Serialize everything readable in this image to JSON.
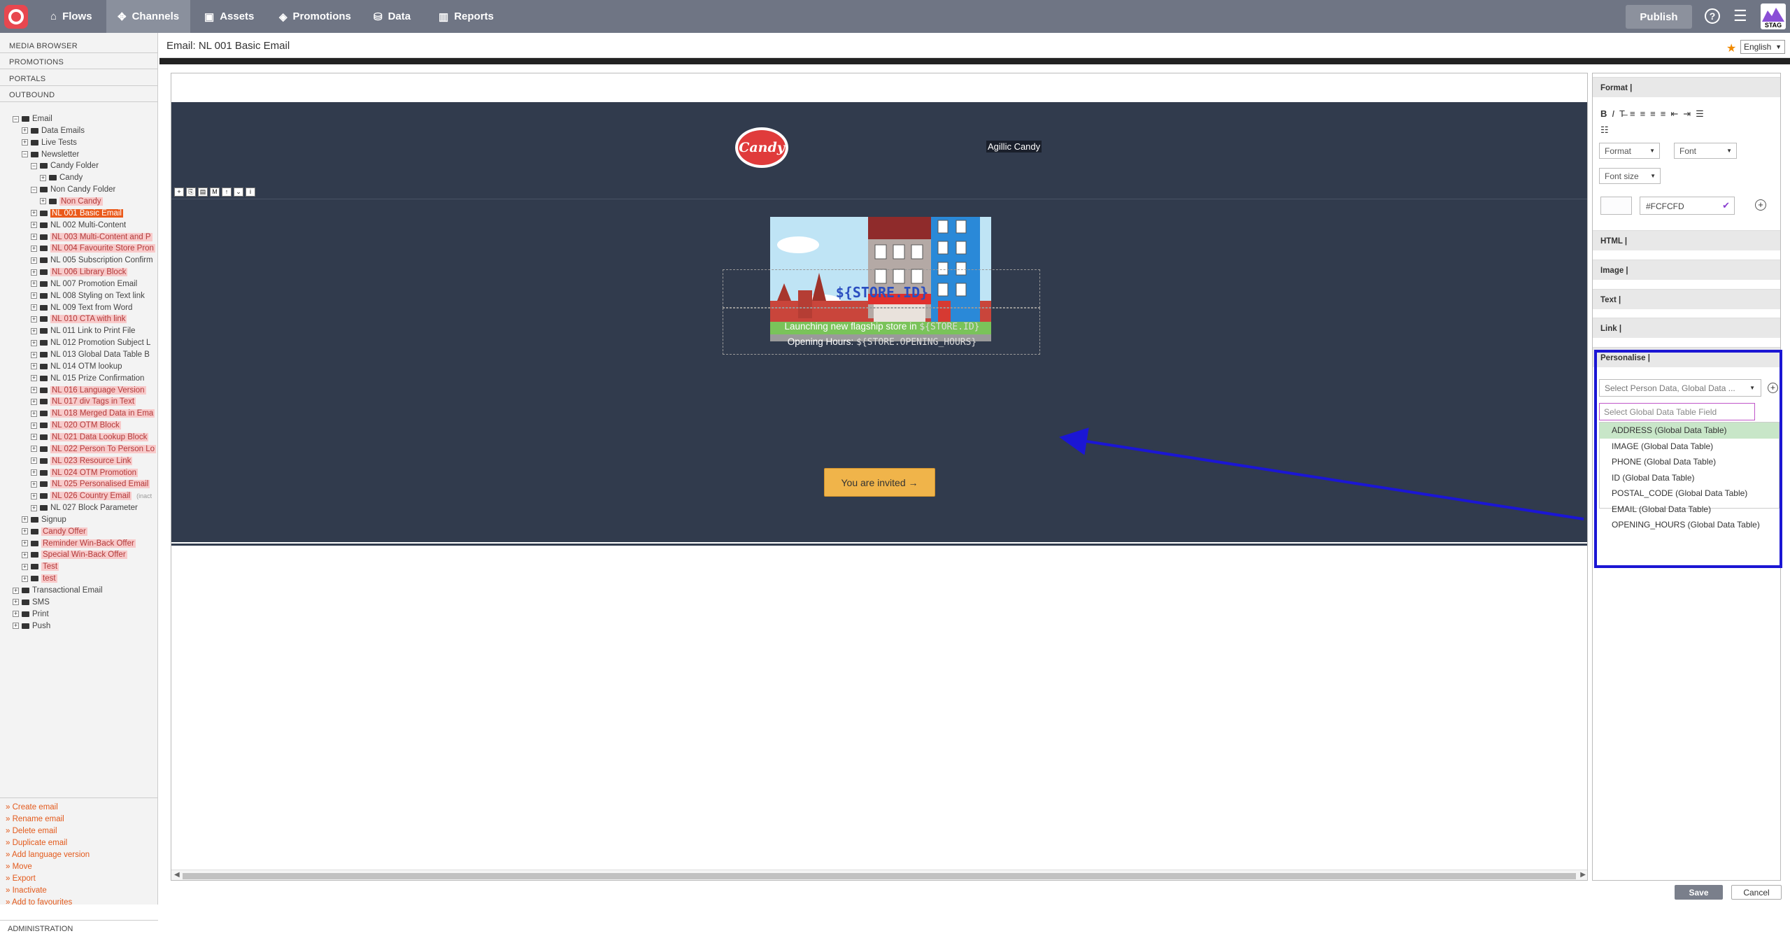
{
  "nav": {
    "items": [
      {
        "label": "Flows",
        "icon": "flows-icon",
        "active": false
      },
      {
        "label": "Channels",
        "icon": "channels-icon",
        "active": true
      },
      {
        "label": "Assets",
        "icon": "assets-icon",
        "active": false
      },
      {
        "label": "Promotions",
        "icon": "promotions-icon",
        "active": false
      },
      {
        "label": "Data",
        "icon": "data-icon",
        "active": false
      },
      {
        "label": "Reports",
        "icon": "reports-icon",
        "active": false
      }
    ],
    "publish_label": "Publish",
    "help_label": "?",
    "env_badge": "STAG"
  },
  "sidebar": {
    "sections": [
      "MEDIA BROWSER",
      "PROMOTIONS",
      "PORTALS",
      "OUTBOUND"
    ],
    "tree": [
      {
        "label": "Email",
        "level": 0,
        "toggle": "−",
        "style": "normal"
      },
      {
        "label": "Data Emails",
        "level": 1,
        "toggle": "+",
        "style": "normal"
      },
      {
        "label": "Live Tests",
        "level": 1,
        "toggle": "+",
        "style": "normal"
      },
      {
        "label": "Newsletter",
        "level": 1,
        "toggle": "−",
        "style": "normal"
      },
      {
        "label": "Candy Folder",
        "level": 2,
        "toggle": "−",
        "style": "normal"
      },
      {
        "label": "Candy",
        "level": 3,
        "toggle": "+",
        "style": "normal"
      },
      {
        "label": "Non Candy Folder",
        "level": 2,
        "toggle": "−",
        "style": "normal"
      },
      {
        "label": "Non Candy",
        "level": 3,
        "toggle": "+",
        "style": "highlight"
      },
      {
        "label": "NL 001 Basic Email",
        "level": 2,
        "toggle": "+",
        "style": "selected"
      },
      {
        "label": "NL 002 Multi-Content",
        "level": 2,
        "toggle": "+",
        "style": "normal"
      },
      {
        "label": "NL 003 Multi-Content and P",
        "level": 2,
        "toggle": "+",
        "style": "highlight"
      },
      {
        "label": "NL 004 Favourite Store Pron",
        "level": 2,
        "toggle": "+",
        "style": "highlight"
      },
      {
        "label": "NL 005 Subscription Confirm",
        "level": 2,
        "toggle": "+",
        "style": "normal"
      },
      {
        "label": "NL 006 Library Block",
        "level": 2,
        "toggle": "+",
        "style": "highlight"
      },
      {
        "label": "NL 007 Promotion Email",
        "level": 2,
        "toggle": "+",
        "style": "normal"
      },
      {
        "label": "NL 008 Styling on Text link",
        "level": 2,
        "toggle": "+",
        "style": "normal"
      },
      {
        "label": "NL 009 Text from Word",
        "level": 2,
        "toggle": "+",
        "style": "normal"
      },
      {
        "label": "NL 010 CTA with link",
        "level": 2,
        "toggle": "+",
        "style": "highlight"
      },
      {
        "label": "NL 011 Link to Print File",
        "level": 2,
        "toggle": "+",
        "style": "normal"
      },
      {
        "label": "NL 012 Promotion Subject L",
        "level": 2,
        "toggle": "+",
        "style": "normal"
      },
      {
        "label": "NL 013 Global Data Table B",
        "level": 2,
        "toggle": "+",
        "style": "normal"
      },
      {
        "label": "NL 014 OTM lookup",
        "level": 2,
        "toggle": "+",
        "style": "normal"
      },
      {
        "label": "NL 015 Prize Confirmation",
        "level": 2,
        "toggle": "+",
        "style": "normal"
      },
      {
        "label": "NL 016 Language Version",
        "level": 2,
        "toggle": "+",
        "style": "highlight"
      },
      {
        "label": "NL 017 div Tags in Text",
        "level": 2,
        "toggle": "+",
        "style": "highlight"
      },
      {
        "label": "NL 018 Merged Data in Ema",
        "level": 2,
        "toggle": "+",
        "style": "highlight"
      },
      {
        "label": "NL 020 OTM Block",
        "level": 2,
        "toggle": "+",
        "style": "highlight"
      },
      {
        "label": "NL 021 Data Lookup Block",
        "level": 2,
        "toggle": "+",
        "style": "highlight"
      },
      {
        "label": "NL 022 Person To Person Lo",
        "level": 2,
        "toggle": "+",
        "style": "highlight"
      },
      {
        "label": "NL 023 Resource Link",
        "level": 2,
        "toggle": "+",
        "style": "highlight"
      },
      {
        "label": "NL 024 OTM Promotion",
        "level": 2,
        "toggle": "+",
        "style": "highlight"
      },
      {
        "label": "NL 025 Personalised Email",
        "level": 2,
        "toggle": "+",
        "style": "highlight"
      },
      {
        "label": "NL 026 Country Email",
        "level": 2,
        "toggle": "+",
        "style": "highlight",
        "suffix": "(inact"
      },
      {
        "label": "NL 027 Block Parameter",
        "level": 2,
        "toggle": "+",
        "style": "normal"
      },
      {
        "label": "Signup",
        "level": 1,
        "toggle": "+",
        "style": "normal"
      },
      {
        "label": "Candy Offer",
        "level": 1,
        "toggle": "+",
        "style": "highlight"
      },
      {
        "label": "Reminder Win-Back Offer",
        "level": 1,
        "toggle": "+",
        "style": "highlight"
      },
      {
        "label": "Special Win-Back Offer",
        "level": 1,
        "toggle": "+",
        "style": "highlight"
      },
      {
        "label": "Test",
        "level": 1,
        "toggle": "+",
        "style": "highlight"
      },
      {
        "label": "test",
        "level": 1,
        "toggle": "+",
        "style": "highlight"
      },
      {
        "label": "Transactional Email",
        "level": 0,
        "toggle": "+",
        "style": "normal"
      },
      {
        "label": "SMS",
        "level": 0,
        "toggle": "+",
        "style": "normal"
      },
      {
        "label": "Print",
        "level": 0,
        "toggle": "+",
        "style": "normal"
      },
      {
        "label": "Push",
        "level": 0,
        "toggle": "+",
        "style": "normal"
      }
    ],
    "actions": [
      "Create email",
      "Rename email",
      "Delete email",
      "Duplicate email",
      "Add language version",
      "Move",
      "Export",
      "Inactivate",
      "Add to favourites"
    ],
    "admin_label": "ADMINISTRATION"
  },
  "header": {
    "title": "Email: NL 001 Basic Email",
    "language": "English"
  },
  "email": {
    "logo_text": "Candy",
    "brand_name": "Agillic Candy",
    "toolbar_icons": [
      "+",
      "⎘",
      "▤",
      "M",
      "↑",
      "⌄",
      "i"
    ],
    "store_id_token": "${STORE.ID}",
    "launch_text": "Launching new flagship store in ",
    "launch_token": "${STORE.ID}",
    "hours_text": "Opening Hours: ",
    "hours_token": "${STORE.OPENING_HOURS}",
    "cta_label": "You are invited →"
  },
  "panel": {
    "format_title": "Format |",
    "format_buttons": [
      "B",
      "I",
      "T̶",
      "≡",
      "≡",
      "≡",
      "≡",
      "⇤",
      "⇥",
      "☰"
    ],
    "format_button2": "☷",
    "format_select": "Format",
    "font_select": "Font",
    "fontsize_select": "Font size",
    "color_value": "#FCFCFD",
    "html_title": "HTML |",
    "image_title": "Image |",
    "text_title": "Text |",
    "link_title": "Link |",
    "personalise_title": "Personalise |",
    "person_select_placeholder": "Select Person Data, Global Data ...",
    "gdt_field_placeholder": "Select Global Data Table Field",
    "options": [
      "ADDRESS (Global Data Table)",
      "IMAGE (Global Data Table)",
      "PHONE (Global Data Table)",
      "ID (Global Data Table)",
      "POSTAL_CODE (Global Data Table)",
      "EMAIL (Global Data Table)",
      "OPENING_HOURS (Global Data Table)"
    ]
  },
  "footer": {
    "save_label": "Save",
    "cancel_label": "Cancel"
  },
  "colors": {
    "nav_bg": "#6f7584",
    "email_bg": "#313b4d",
    "accent_orange": "#e35a1c",
    "cta": "#f0b44a",
    "annotation_blue": "#1b16d4"
  }
}
